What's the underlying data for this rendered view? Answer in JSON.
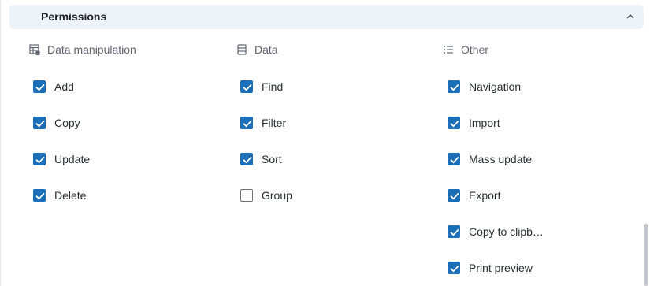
{
  "section": {
    "title": "Permissions",
    "collapse_icon": "chevron-up-icon"
  },
  "columns": [
    {
      "key": "data-manipulation",
      "title": "Data manipulation",
      "icon": "table-edit-icon",
      "items": [
        {
          "label": "Add",
          "checked": true
        },
        {
          "label": "Copy",
          "checked": true
        },
        {
          "label": "Update",
          "checked": true
        },
        {
          "label": "Delete",
          "checked": true
        }
      ]
    },
    {
      "key": "data",
      "title": "Data",
      "icon": "list-box-icon",
      "items": [
        {
          "label": "Find",
          "checked": true
        },
        {
          "label": "Filter",
          "checked": true
        },
        {
          "label": "Sort",
          "checked": true
        },
        {
          "label": "Group",
          "checked": false
        }
      ]
    },
    {
      "key": "other",
      "title": "Other",
      "icon": "bullet-list-icon",
      "items": [
        {
          "label": "Navigation",
          "checked": true
        },
        {
          "label": "Import",
          "checked": true
        },
        {
          "label": "Mass update",
          "checked": true
        },
        {
          "label": "Export",
          "checked": true
        },
        {
          "label": "Copy to clipb…",
          "checked": true
        },
        {
          "label": "Print preview",
          "checked": true
        }
      ]
    }
  ],
  "colors": {
    "checkbox_checked": "#1a6fb8",
    "header_background": "#eef3fa",
    "column_title": "#5f6670"
  }
}
